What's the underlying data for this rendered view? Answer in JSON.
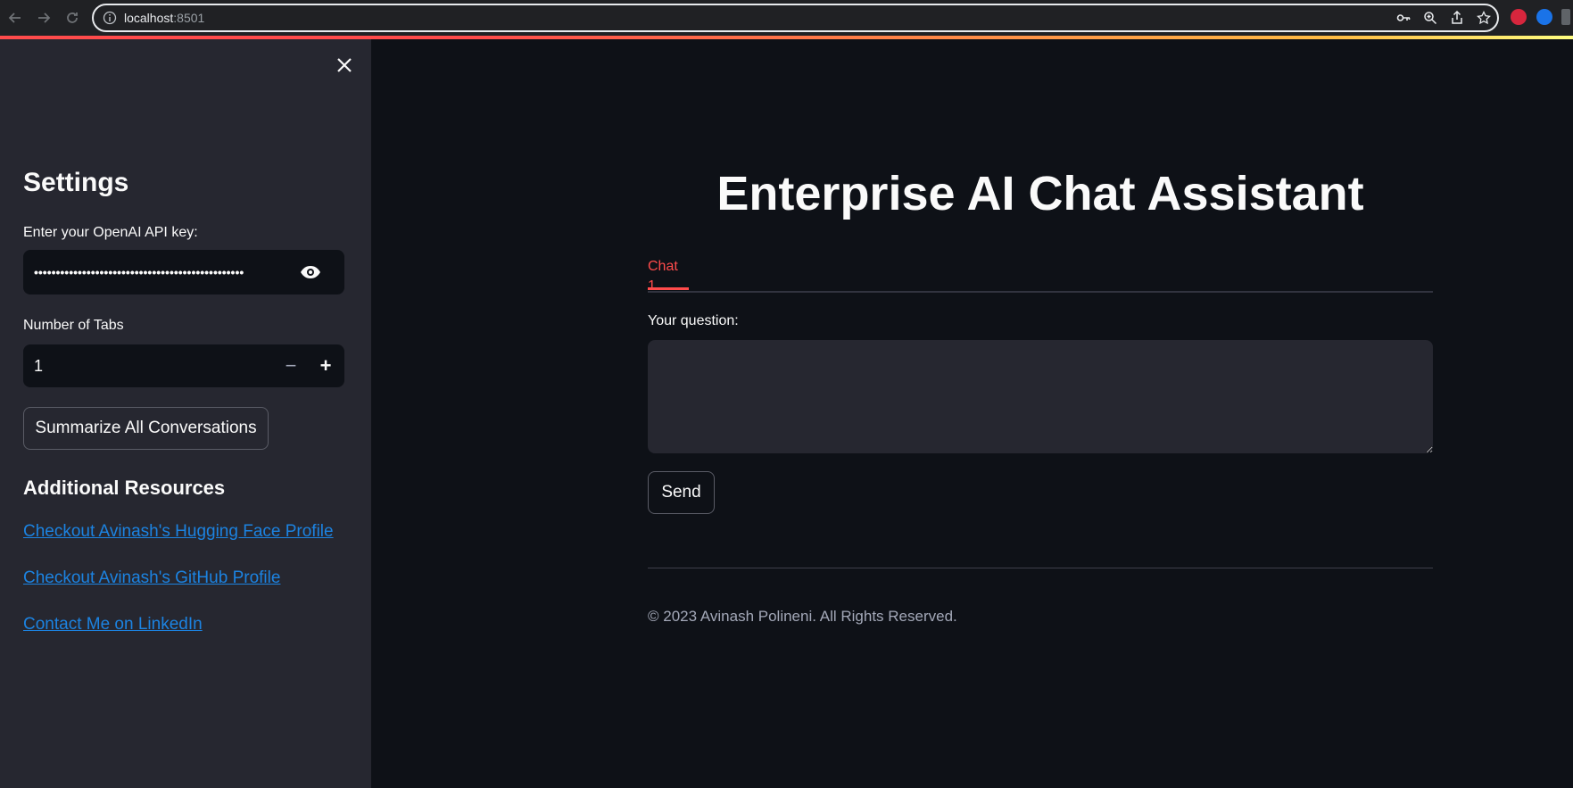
{
  "browser": {
    "url_host": "localhost",
    "url_port": ":8501"
  },
  "sidebar": {
    "title": "Settings",
    "api_key_label": "Enter your OpenAI API key:",
    "api_key_value": "••••••••••••••••••••••••••••••••••••••••••••••••",
    "tabs_label": "Number of Tabs",
    "tabs_value": "1",
    "minus": "−",
    "plus": "+",
    "summarize_button": "Summarize All Conversations",
    "resources_title": "Additional Resources",
    "links": [
      "Checkout Avinash's Hugging Face Profile",
      "Checkout Avinash's GitHub Profile",
      "Contact Me on LinkedIn"
    ]
  },
  "main": {
    "title": "Enterprise AI Chat Assistant",
    "tabs": [
      {
        "label": "Chat 1"
      }
    ],
    "question_label": "Your question:",
    "question_value": "",
    "send_button": "Send",
    "footer": "© 2023 Avinash Polineni. All Rights Reserved."
  },
  "colors": {
    "accent": "#ff4b4b",
    "link": "#1c83e1",
    "background": "#0e1117",
    "sidebar_bg": "#262730"
  }
}
